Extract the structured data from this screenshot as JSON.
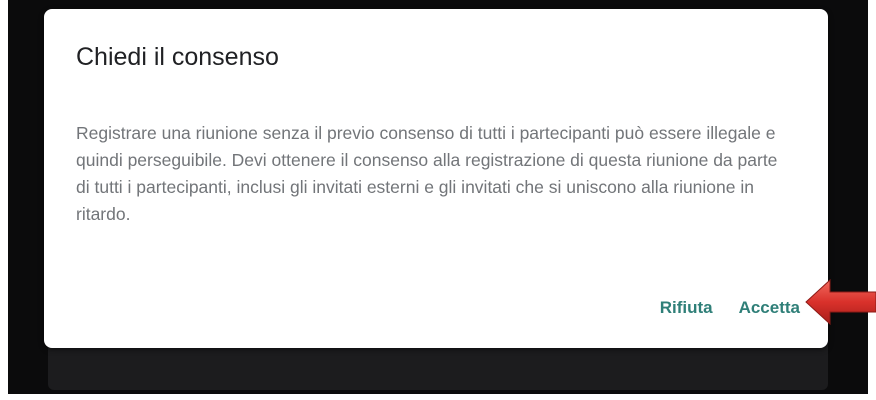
{
  "dialog": {
    "title": "Chiedi il consenso",
    "body": "Registrare una riunione senza il previo consenso di tutti i partecipanti può essere illegale e quindi perseguibile. Devi ottenere il consenso alla registrazione di questa riunione da parte di tutti i partecipanti, inclusi gli invitati esterni e gli invitati che si uniscono alla riunione in ritardo.",
    "reject_label": "Rifiuta",
    "accept_label": "Accetta"
  },
  "colors": {
    "accent": "#2f7f78",
    "body_text": "#727579",
    "backdrop": "#0b0b0c",
    "arrow": "#d9312b"
  },
  "annotation": {
    "icon": "red-arrow-icon"
  }
}
